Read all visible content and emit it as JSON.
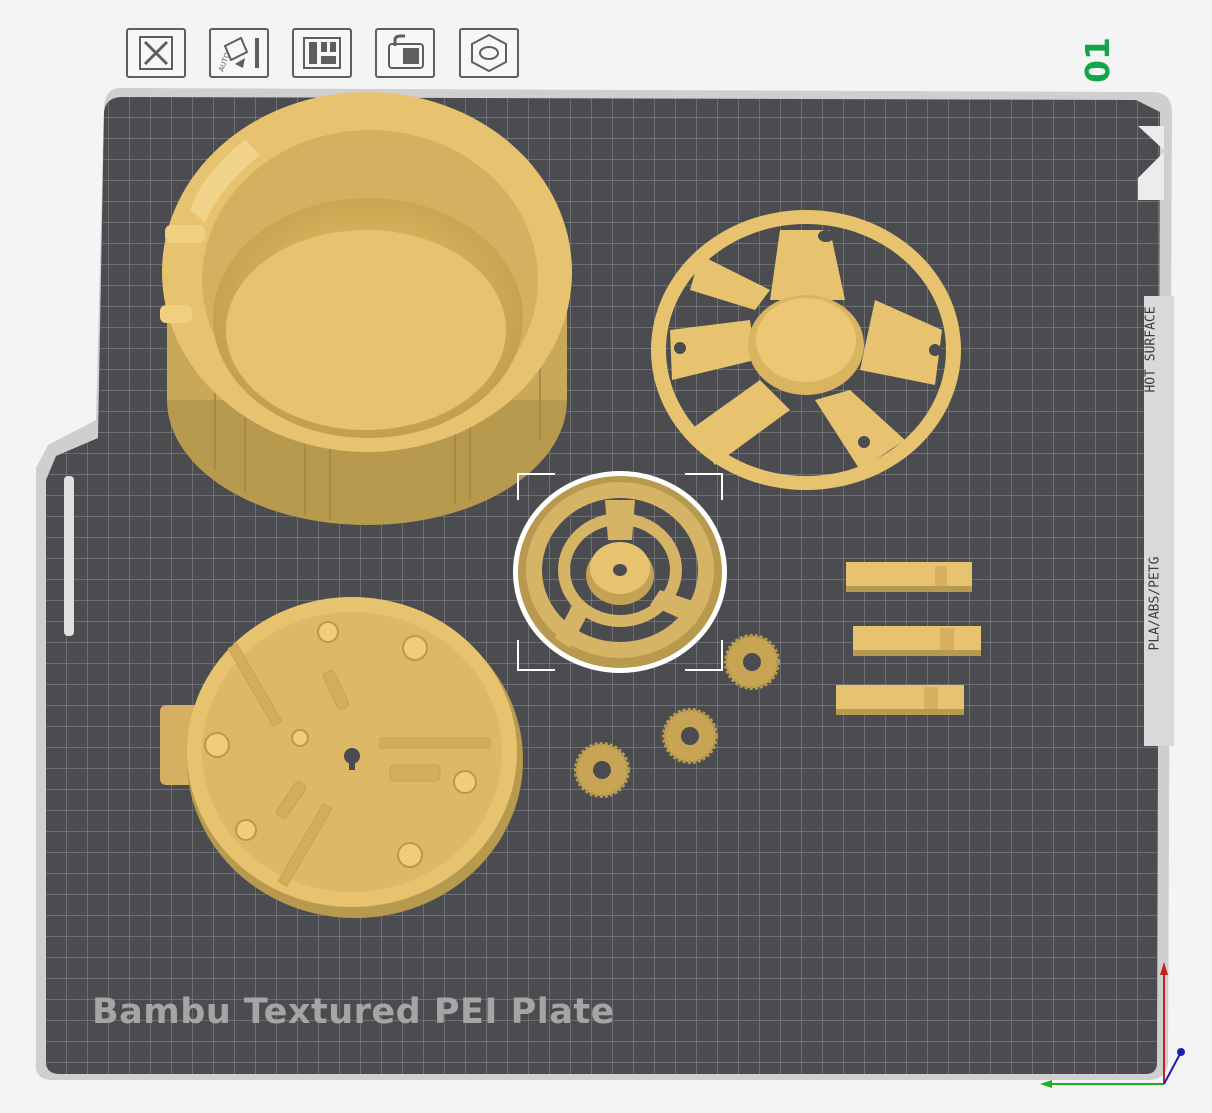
{
  "plate": {
    "name": "Bambu Textured PEI Plate",
    "index": "01",
    "filament_compatibility": "PLA/ABS/PETG",
    "hot_surface_warning": "HOT SURFACE"
  },
  "toolbar": {
    "buttons": [
      {
        "name": "delete-plate",
        "icon": "close-icon"
      },
      {
        "name": "auto-orient",
        "icon": "auto-orient-icon",
        "badge": "AUTO"
      },
      {
        "name": "arrange",
        "icon": "arrange-icon"
      },
      {
        "name": "lock-plate",
        "icon": "lock-icon"
      },
      {
        "name": "plate-settings",
        "icon": "hex-nut-icon"
      }
    ]
  },
  "objects": [
    {
      "name": "cylindrical-housing",
      "selected": false
    },
    {
      "name": "spoked-ring-frame",
      "selected": false
    },
    {
      "name": "large-spur-gear",
      "selected": true
    },
    {
      "name": "base-plate",
      "selected": false
    },
    {
      "name": "small-gear-1",
      "selected": false
    },
    {
      "name": "small-gear-2",
      "selected": false
    },
    {
      "name": "small-gear-3",
      "selected": false
    },
    {
      "name": "rack-1",
      "selected": false
    },
    {
      "name": "rack-2",
      "selected": false
    },
    {
      "name": "rack-3",
      "selected": false
    }
  ],
  "axes": {
    "x_color": "#1bb31b",
    "y_color": "#c81e1e",
    "z_color": "#1e1eb4"
  },
  "colors": {
    "plate": "#4a4c4f",
    "grid_line": "#8d9194",
    "frame": "#cfcfcf",
    "model": "#e8c36f",
    "model_shadow": "#b89a4e",
    "selection": "#ffffff",
    "index_text": "#13a547"
  }
}
